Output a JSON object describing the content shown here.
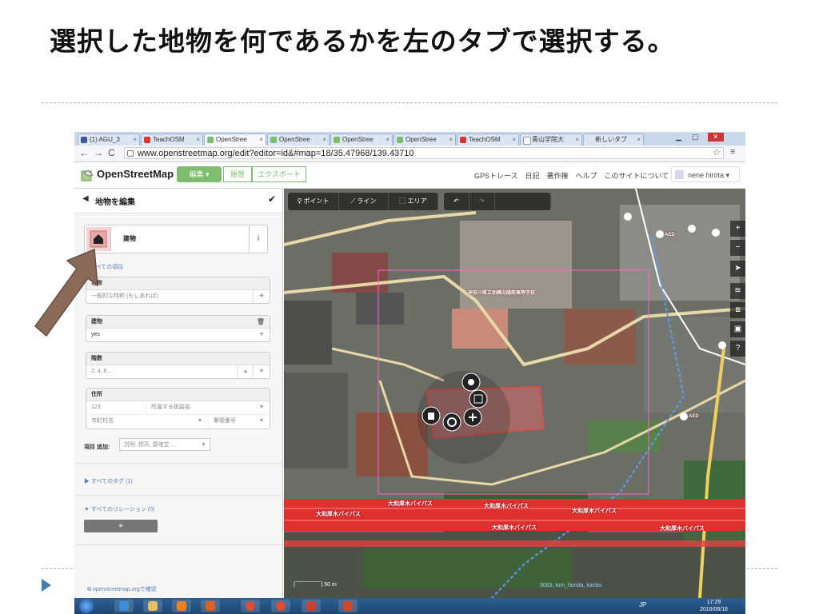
{
  "slide": {
    "title": "選択した地物を何であるかを左のタブで選択する。"
  },
  "browser": {
    "tabs": [
      "(1) AGU_3",
      "TeachOSM",
      "OpenStree",
      "OpenStree",
      "OpenStree",
      "OpenStree",
      "TeachOSM",
      "青山学院大",
      "新しいタブ"
    ],
    "url": "www.openstreetmap.org/edit?editor=id&#map=18/35.47968/139.43710"
  },
  "osm": {
    "brand": "OpenStreetMap",
    "edit_label": "編集",
    "history_label": "履歴",
    "export_label": "エクスポート",
    "nav_links": "GPSトレース　日記　著作権　ヘルプ　このサイトについて",
    "user_name": "nene hirota"
  },
  "sidebar": {
    "header_title": "地物を編集",
    "preset_name": "建物",
    "all_fields_link": "すべての項目",
    "fields": {
      "name_label": "名称",
      "name_placeholder": "一般的な特称 (もしあれば)",
      "building_label": "建物",
      "building_value": "yes",
      "levels_label": "階数",
      "levels_placeholder": "2, 4, 6...",
      "address_label": "住所",
      "housenumber_placeholder": "123",
      "street_placeholder": "所属する街路名",
      "city_placeholder": "市町村名",
      "postcode_placeholder": "郵便番号"
    },
    "add_field_label": "項目 追加:",
    "add_field_placeholder": "説明, 標高, 要確定 ...",
    "all_tags_link": "▶ すべてのタグ (1)",
    "all_relations_link": "▼ すべてのリレーション (0)",
    "add_button": "+",
    "view_on_osm": "openstreetmap.orgで確認"
  },
  "map_tools": {
    "point": "ポイント",
    "line": "ライン",
    "area": "エリア"
  },
  "map": {
    "road_label": "大和厚木バイパス",
    "school_label": "神奈川県立相模向陽館高等学校",
    "aed_label": "AED",
    "scale": "50 m",
    "attribution": "5063, tom_honda, kanbo"
  },
  "taskbar": {
    "lang": "JP",
    "time": "17:29",
    "date": "2016/06/16"
  },
  "colors": {
    "osm_green": "#7ebc6f",
    "road_red": "#e03030",
    "selection_pink": "#ff66cc",
    "arrow_brown": "#8b6a5a"
  }
}
